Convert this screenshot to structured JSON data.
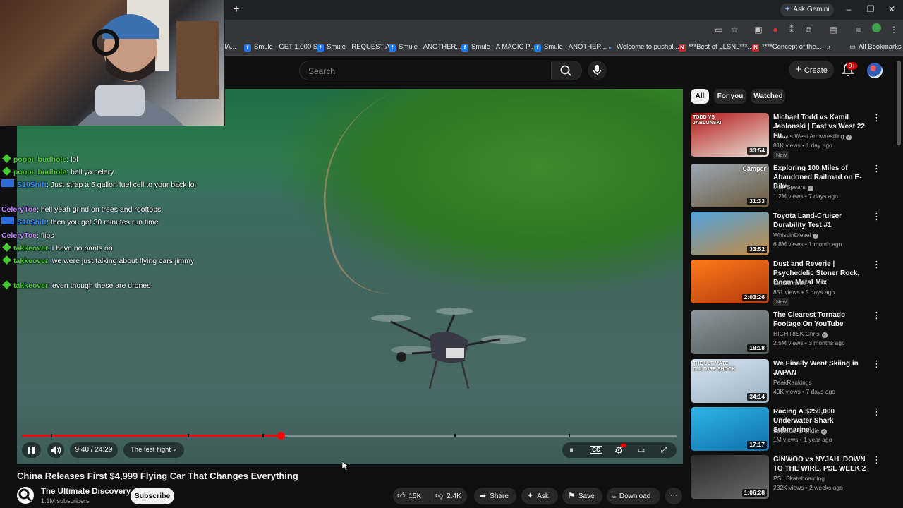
{
  "browser": {
    "new_tab_glyph": "+",
    "gemini_label": "Ask Gemini",
    "bookmarks": [
      "IA...",
      "Smule - GET 1,000 S...",
      "Smule - REQUEST A...",
      "Smule - ANOTHER...",
      "Smule - A MAGIC Pl...",
      "Smule - ANOTHER...",
      "Welcome to pushpl...",
      "***Best of LLSNL***...",
      "****Concept of the...",
      "All Bookmarks"
    ]
  },
  "header": {
    "search_placeholder": "Search",
    "create_label": "Create",
    "notification_badge": "9+"
  },
  "chat": [
    {
      "user": "poopi_budhole",
      "text": ": lol",
      "color": "#45c930",
      "badge": "gem"
    },
    {
      "user": "poopi_budhole",
      "text": ": hell ya celery",
      "color": "#45c930",
      "badge": "gem"
    },
    {
      "user": "S10Shift",
      "text": ": Just strap a 5 gallon fuel cell to your back lol",
      "color": "#2d8cff",
      "badge": "cam"
    },
    {
      "user": "CeleryToe",
      "text": ": hell yeah grind on trees and rooftops",
      "color": "#c483ff",
      "badge": "none"
    },
    {
      "user": "S10Shift",
      "text": ": then you get 30 minutes run time",
      "color": "#2d8cff",
      "badge": "cam"
    },
    {
      "user": "CeleryToe",
      "text": ": flips",
      "color": "#c483ff",
      "badge": "none"
    },
    {
      "user": "takkeover",
      "text": ": i have no pants on",
      "color": "#45c930",
      "badge": "gem"
    },
    {
      "user": "takkeover",
      "text": ": we were just talking about flying cars jimmy",
      "color": "#45c930",
      "badge": "gem"
    },
    {
      "user": "takkeover",
      "text": ": even though these are drones",
      "color": "#45c930",
      "badge": "gem"
    }
  ],
  "player": {
    "time": "9:40 / 24:29",
    "chapter": "The test flight",
    "progress_fraction": 0.395
  },
  "video": {
    "title": "China Releases First $4,999 Flying Car That Changes Everything",
    "channel": "The Ultimate Discovery",
    "subscribers": "1.1M subscribers",
    "subscribe_label": "Subscribe",
    "likes": "15K",
    "dislikes": "2.4K",
    "share_label": "Share",
    "ask_label": "Ask",
    "save_label": "Save",
    "download_label": "Download"
  },
  "sidebar": {
    "chips": [
      "All",
      "For you",
      "Watched"
    ],
    "recs": [
      {
        "title": "Michael Todd vs Kamil Jablonski | East vs West 22 Fu...",
        "channel": "East vs West Armwrestling",
        "verified": true,
        "meta": "81K views • 1 day ago",
        "badge": "New",
        "duration": "33:54",
        "thumb": [
          "#b51717",
          "#e8e2d8"
        ],
        "overlay": "TODD VS JABLONSKI"
      },
      {
        "title": "Exploring 100 Miles of Abandoned Railroad on E-Bike...",
        "channel": "Matt Spears",
        "verified": true,
        "meta": "1.2M views • 7 days ago",
        "badge": "",
        "duration": "31:33",
        "thumb": [
          "#9aa7b3",
          "#6d5a3c"
        ],
        "overlay": "Camper"
      },
      {
        "title": "Toyota Land-Cruiser Durability Test #1",
        "channel": "WhistlinDiesel",
        "verified": true,
        "meta": "6.8M views • 1 month ago",
        "badge": "",
        "duration": "33:52",
        "thumb": [
          "#4ea3df",
          "#c68a3f"
        ],
        "overlay": ""
      },
      {
        "title": "Dust and Reverie | Psychedelic Stoner Rock, Doom Metal Mix",
        "channel": "SandSmoke",
        "verified": false,
        "meta": "851 views • 5 days ago",
        "badge": "New",
        "duration": "2:03:26",
        "thumb": [
          "#ff7a1a",
          "#b33a0d"
        ],
        "overlay": ""
      },
      {
        "title": "The Clearest Tornado Footage On YouTube",
        "channel": "HIGH RISK Chris",
        "verified": true,
        "meta": "2.5M views • 3 months ago",
        "badge": "",
        "duration": "18:18",
        "thumb": [
          "#8e979e",
          "#4f5a58"
        ],
        "overlay": ""
      },
      {
        "title": "We Finally Went Skiing in JAPAN",
        "channel": "PeakRankings",
        "verified": false,
        "meta": "40K views • 7 days ago",
        "badge": "",
        "duration": "34:14",
        "thumb": [
          "#d9e5ef",
          "#9bb1c5"
        ],
        "overlay": "THE ULTIMATE CULTURE SHOCK"
      },
      {
        "title": "Racing A $250,000 Underwater Shark Submarine!",
        "channel": "Supercar Blondie",
        "verified": true,
        "meta": "1M views • 1 year ago",
        "badge": "",
        "duration": "17:17",
        "thumb": [
          "#2fb6e8",
          "#0f6fa8"
        ],
        "overlay": ""
      },
      {
        "title": "GINWOO vs NYJAH. DOWN TO THE WIRE. PSL WEEK 2",
        "channel": "PSL Skateboarding",
        "verified": false,
        "meta": "232K views • 2 weeks ago",
        "badge": "",
        "duration": "1:06:28",
        "thumb": [
          "#2a2a2a",
          "#6b6b6b"
        ],
        "overlay": ""
      }
    ]
  }
}
